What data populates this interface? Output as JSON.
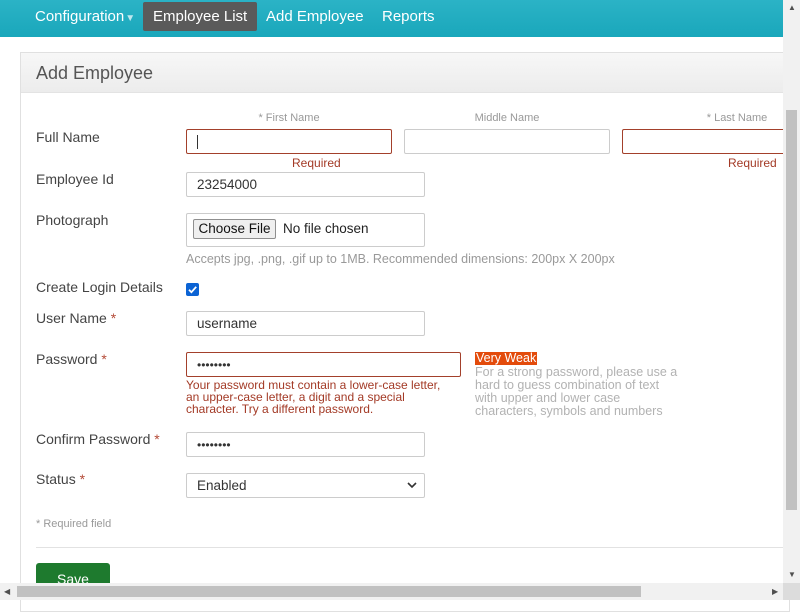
{
  "nav": {
    "items": [
      {
        "label": "Configuration",
        "has_dropdown": true,
        "active": false
      },
      {
        "label": "Employee List",
        "active": true
      },
      {
        "label": "Add Employee",
        "active": false
      },
      {
        "label": "Reports",
        "active": false
      }
    ]
  },
  "panel": {
    "title": "Add Employee"
  },
  "form": {
    "full_name": {
      "label": "Full Name",
      "first": {
        "header": "* First Name",
        "value": "",
        "error": "Required"
      },
      "middle": {
        "header": "Middle Name",
        "value": ""
      },
      "last": {
        "header": "* Last Name",
        "value": "",
        "error": "Required"
      }
    },
    "employee_id": {
      "label": "Employee Id",
      "value": "23254000"
    },
    "photograph": {
      "label": "Photograph",
      "button_label": "Choose File",
      "status": "No file chosen",
      "hint": "Accepts jpg, .png, .gif up to 1MB. Recommended dimensions: 200px X 200px"
    },
    "create_login": {
      "label": "Create Login Details",
      "checked": true
    },
    "username": {
      "label": "User Name",
      "required_mark": "*",
      "value": "username"
    },
    "password": {
      "label": "Password",
      "required_mark": "*",
      "value": "••••••••",
      "strength": "Very Weak",
      "strength_hint": "For a strong password, please use a hard to guess combination of text with upper and lower case characters, symbols and numbers",
      "error": "Your password must contain a lower-case letter, an upper-case letter, a digit and a special character. Try a different password."
    },
    "confirm_password": {
      "label": "Confirm Password",
      "required_mark": "*",
      "value": "••••••••"
    },
    "status": {
      "label": "Status",
      "required_mark": "*",
      "selected": "Enabled"
    },
    "required_note": "* Required field",
    "save_label": "Save"
  },
  "colors": {
    "nav_bg": "#1aa7bb",
    "active_tab": "#5a5a5a",
    "error": "#a33a26",
    "strength_bad": "#e34b0b",
    "save_button": "#1e7a2e"
  }
}
